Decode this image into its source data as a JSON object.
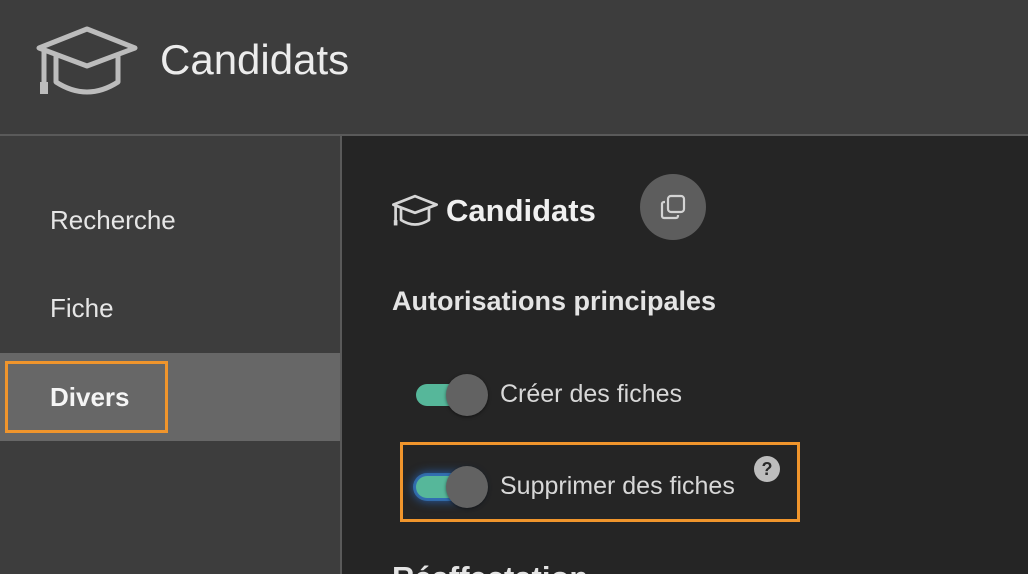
{
  "header": {
    "title": "Candidats",
    "icon": "graduation-cap-icon"
  },
  "sidebar": {
    "items": [
      {
        "label": "Recherche",
        "active": false
      },
      {
        "label": "Fiche",
        "active": false
      },
      {
        "label": "Divers",
        "active": true
      }
    ]
  },
  "content": {
    "title": "Candidats",
    "title_icon": "graduation-cap-icon",
    "copy_icon": "copy-icon",
    "section_heading": "Autorisations principales",
    "permissions": [
      {
        "label": "Créer des fiches",
        "enabled": true
      },
      {
        "label": "Supprimer des fiches",
        "enabled": true,
        "help": "?"
      }
    ],
    "next_section_partial": "Réaffectation"
  },
  "colors": {
    "accent_toggle": "#56b79a",
    "focus_outline": "#f0952c",
    "active_nav": "#676767"
  }
}
